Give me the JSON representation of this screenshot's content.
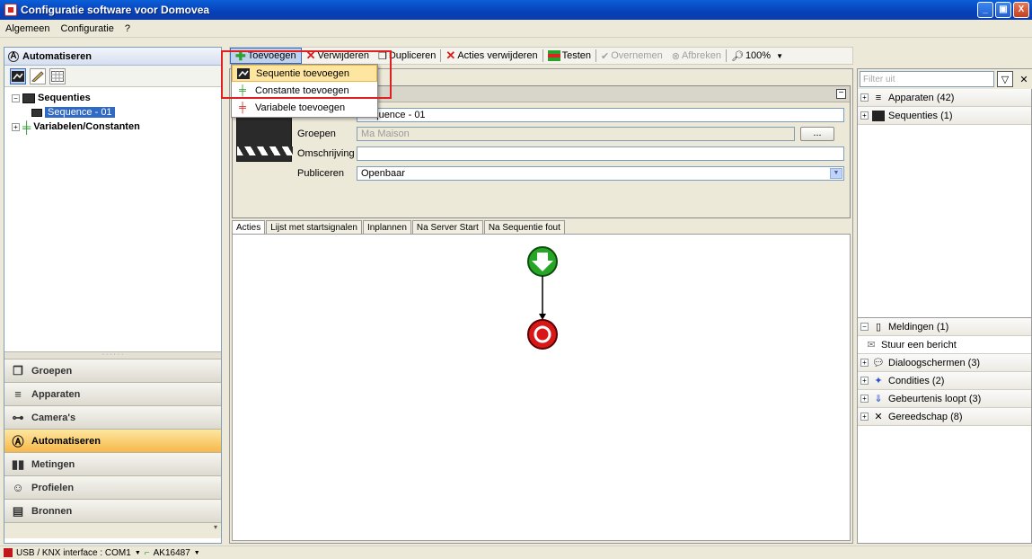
{
  "window": {
    "title": "Configuratie software voor Domovea",
    "minimize": "_",
    "maximize": "▣",
    "close": "X"
  },
  "menu": [
    "Algemeen",
    "Configuratie",
    "?"
  ],
  "left_panel": {
    "header": "Automatiseren",
    "tree": {
      "sequences_label": "Sequenties",
      "sequence_item": "Sequence - 01",
      "variables_label": "Variabelen/Constanten"
    },
    "nav": [
      {
        "label": "Groepen",
        "icon": "groups-icon"
      },
      {
        "label": "Apparaten",
        "icon": "devices-icon"
      },
      {
        "label": "Camera's",
        "icon": "camera-icon"
      },
      {
        "label": "Automatiseren",
        "icon": "automation-icon"
      },
      {
        "label": "Metingen",
        "icon": "measurements-icon"
      },
      {
        "label": "Profielen",
        "icon": "profiles-icon"
      },
      {
        "label": "Bronnen",
        "icon": "sources-icon"
      }
    ]
  },
  "toolbar": {
    "add": "Toevoegen",
    "delete": "Verwijderen",
    "duplicate": "Dupliceren",
    "delete_actions": "Acties verwijderen",
    "test": "Testen",
    "apply": "Overnemen",
    "cancel": "Afbreken",
    "zoom": "100%"
  },
  "dropdown": {
    "items": [
      "Sequentie toevoegen",
      "Constante toevoegen",
      "Variabele toevoegen"
    ]
  },
  "properties": {
    "name_value": "Sequence - 01",
    "groups_label": "Groepen",
    "groups_value": "Ma Maison",
    "groups_button": "...",
    "description_label": "Omschrijving",
    "description_value": "",
    "publish_label": "Publiceren",
    "publish_value": "Openbaar"
  },
  "tabs": [
    "Acties",
    "Lijst met startsignalen",
    "Inplannen",
    "Na Server Start",
    "Na Sequentie fout"
  ],
  "right_panel": {
    "filter_placeholder": "Filter uit",
    "top_items": [
      "Apparaten (42)",
      "Sequenties (1)"
    ],
    "meldingen": "Meldingen (1)",
    "meldingen_child": "Stuur een bericht",
    "bottom_items": [
      "Dialoogschermen (3)",
      "Condities (2)",
      "Gebeurtenis loopt (3)",
      "Gereedschap (8)"
    ]
  },
  "status": {
    "interface": "USB / KNX interface : COM1",
    "device": "AK16487"
  }
}
